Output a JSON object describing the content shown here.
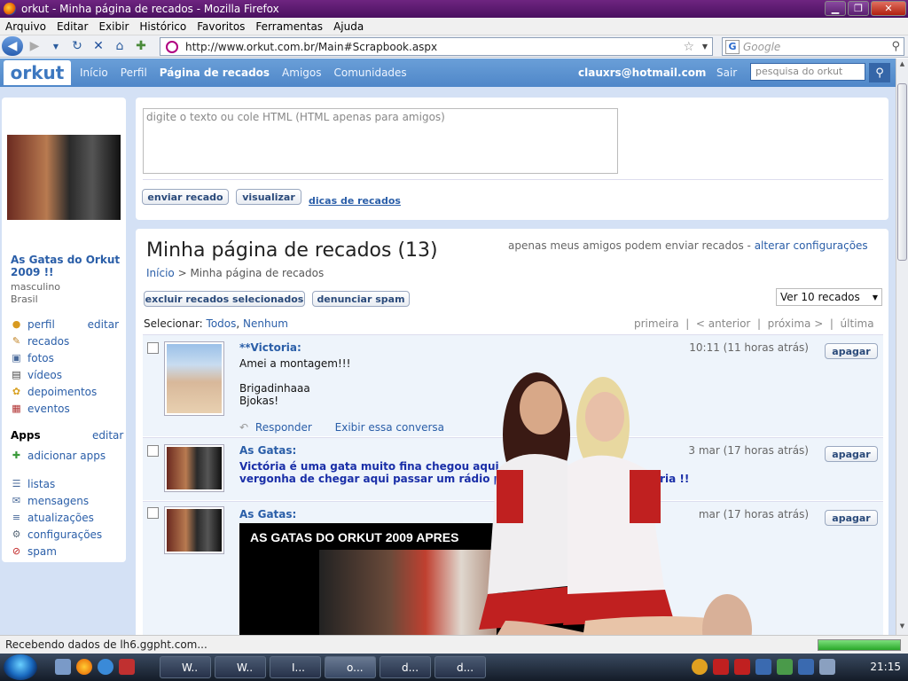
{
  "window": {
    "title": "orkut - Minha página de recados - Mozilla Firefox",
    "min_label": "▁",
    "max_label": "❐",
    "close_label": "✕"
  },
  "menubar": {
    "items": [
      "Arquivo",
      "Editar",
      "Exibir",
      "Histórico",
      "Favoritos",
      "Ferramentas",
      "Ajuda"
    ]
  },
  "navbar": {
    "url": "http://www.orkut.com.br/Main#Scrapbook.aspx",
    "search_placeholder": "Google",
    "search_engine_letter": "G"
  },
  "orkut_header": {
    "logo_text": "orkut",
    "nav": [
      "Início",
      "Perfil",
      "Página de recados",
      "Amigos",
      "Comunidades"
    ],
    "active_nav": "Página de recados",
    "user_email": "clauxrs@hotmail.com",
    "logout": "Sair",
    "search_placeholder": "pesquisa do orkut"
  },
  "profile": {
    "name": "As Gatas do Orkut 2009 !!",
    "gender": "masculino",
    "country": "Brasil",
    "menu": [
      {
        "label": "perfil",
        "edit": "editar"
      },
      {
        "label": "recados"
      },
      {
        "label": "fotos"
      },
      {
        "label": "vídeos"
      },
      {
        "label": "depoimentos"
      },
      {
        "label": "eventos"
      }
    ],
    "apps_title": "Apps",
    "apps_edit": "editar",
    "apps_add": "adicionar apps",
    "menu2": [
      {
        "label": "listas"
      },
      {
        "label": "mensagens"
      },
      {
        "label": "atualizações"
      },
      {
        "label": "configurações"
      },
      {
        "label": "spam"
      }
    ]
  },
  "compose": {
    "placeholder": "digite o texto ou cole HTML (HTML apenas para amigos)",
    "send": "enviar recado",
    "preview": "visualizar",
    "tips": "dicas de recados"
  },
  "scrapbook": {
    "title": "Minha página de recados (13)",
    "notice": "apenas meus amigos podem enviar recados - ",
    "notice_link": "alterar configurações",
    "breadcrumb_home": "Início",
    "breadcrumb_sep": " > ",
    "breadcrumb_current": "Minha página de recados",
    "delete_selected": "excluir recados selecionados",
    "report_spam": "denunciar spam",
    "view_select": "Ver 10 recados",
    "select_label": "Selecionar: ",
    "select_all": "Todos",
    "select_sep": ", ",
    "select_none": "Nenhum",
    "pager": "primeira  |  < anterior  |  próxima >  |  última",
    "scraps": [
      {
        "author": "**Victoria:",
        "time": "10:11 (11 horas atrás)",
        "delete": "apagar",
        "text": "Amei a montagem!!!\n\nBrigadinhaaa\nBjokas!",
        "reply": "Responder",
        "conversation": "Exibir essa conversa"
      },
      {
        "author": "As Gatas:",
        "time": "3 mar (17 horas atrás)",
        "delete": "apagar",
        "text": "Victória é uma gata muito fina chegou aqui             eu\nvergonha de chegar aqui passar um rádio p                              ão victoria !!"
      },
      {
        "author": "As Gatas:",
        "time": "mar (17 horas atrás)",
        "delete": "apagar",
        "video_title": "AS GATAS DO ORKUT 2009 APRES              OR."
      }
    ]
  },
  "statusbar": {
    "text": "Recebendo dados de lh6.ggpht.com...",
    "progress": 1.0
  },
  "taskbar": {
    "tasks": [
      "W..",
      "W..",
      "I...",
      "o...",
      "d...",
      "d..."
    ],
    "clock": "21:15"
  },
  "colors": {
    "orkut_blue": "#5b8fd0",
    "page_bg": "#d4e1f5",
    "link": "#2a5ea8",
    "titlebar": "#5a1a70"
  }
}
